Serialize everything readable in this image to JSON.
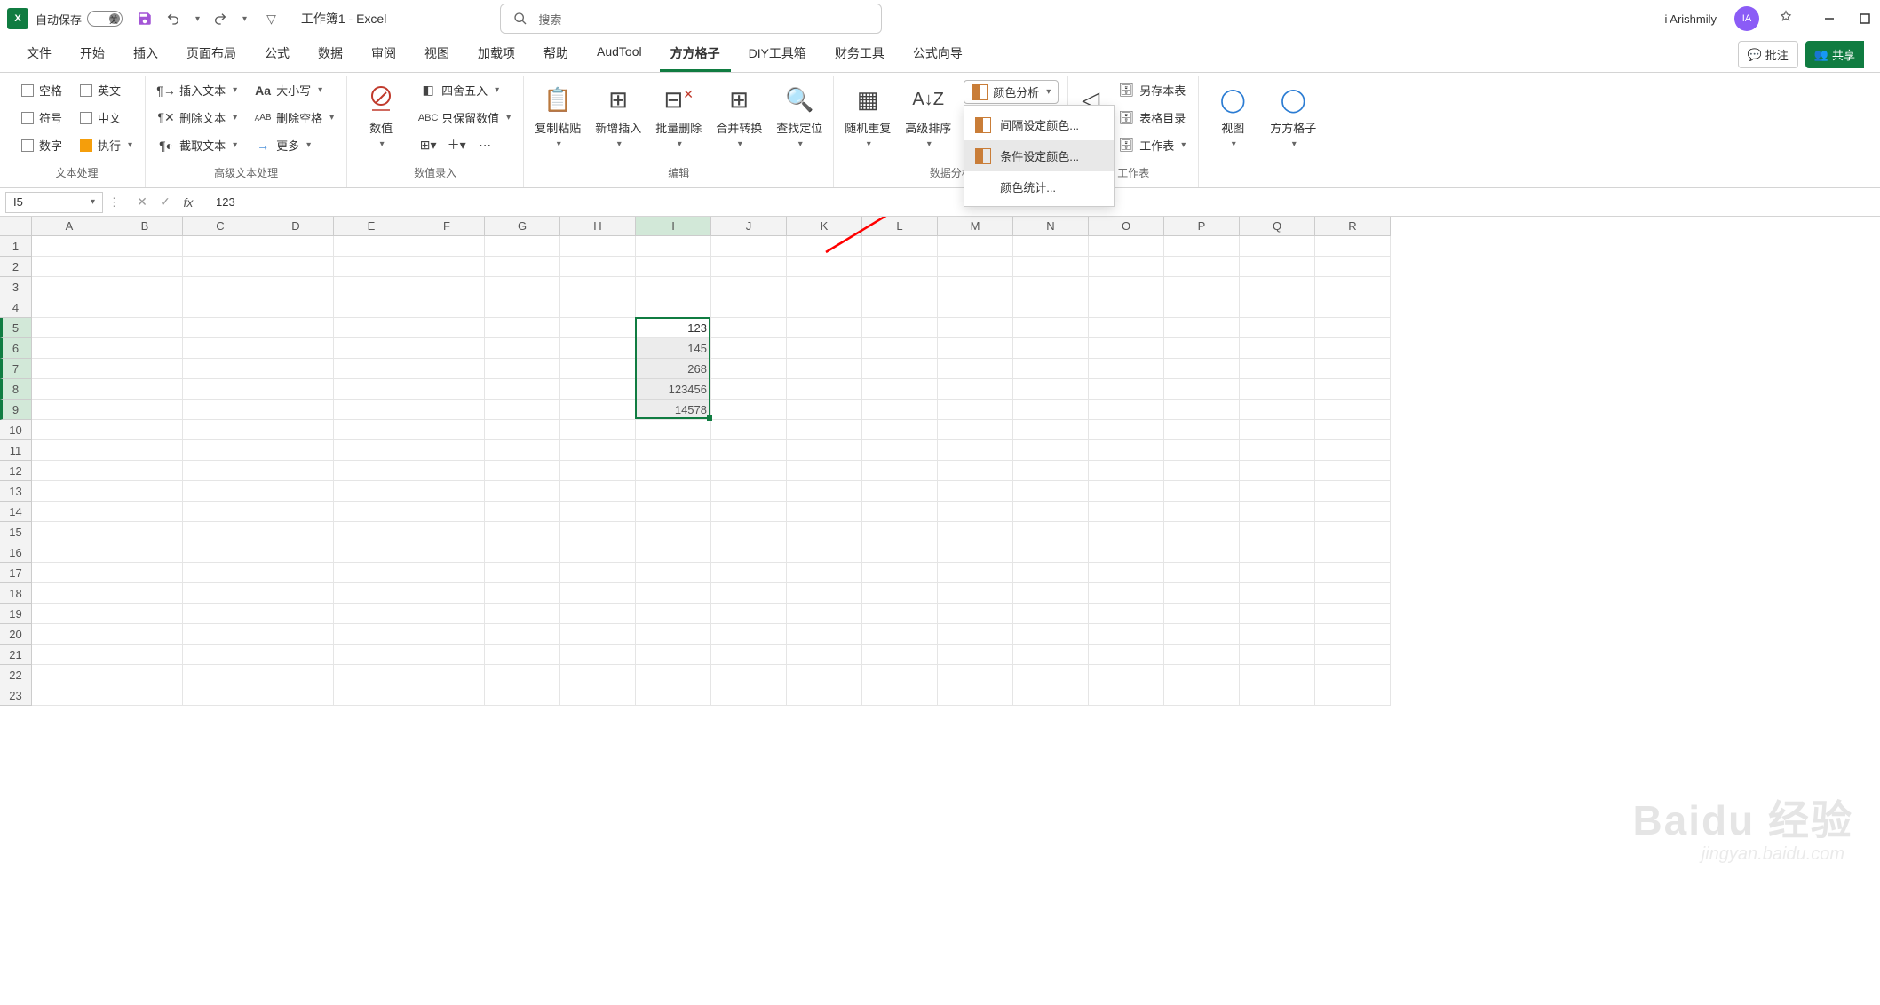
{
  "title_bar": {
    "app_icon_letter": "X",
    "autosave_label": "自动保存",
    "toggle_text": "关",
    "doc_title": "工作簿1  -  Excel",
    "search_placeholder": "搜索",
    "user_name": "i Arishmily",
    "user_initials": "IA"
  },
  "ribbon_tabs": [
    "文件",
    "开始",
    "插入",
    "页面布局",
    "公式",
    "数据",
    "审阅",
    "视图",
    "加载项",
    "帮助",
    "AudTool",
    "方方格子",
    "DIY工具箱",
    "财务工具",
    "公式向导"
  ],
  "active_tab_index": 11,
  "comments_btn": "批注",
  "share_btn": "共享",
  "ribbon_groups": {
    "text_processing": {
      "label": "文本处理",
      "items": [
        "空格",
        "英文",
        "符号",
        "中文",
        "数字",
        "执行"
      ]
    },
    "adv_text": {
      "label": "高级文本处理",
      "insert_text": "插入文本",
      "delete_text": "删除文本",
      "extract_text": "截取文本",
      "case": "大小写",
      "del_space": "删除空格",
      "more": "更多"
    },
    "num_input": {
      "label": "数值录入",
      "value": "数值",
      "round": "四舍五入",
      "keep_num": "只保留数值"
    },
    "edit": {
      "label": "编辑",
      "copy_paste": "复制粘贴",
      "new_insert": "新增插入",
      "batch_del": "批量删除",
      "merge_trans": "合并转换",
      "find_locate": "查找定位"
    },
    "data_analysis": {
      "label": "数据分析",
      "random_repeat": "随机重复",
      "adv_sort": "高级排序",
      "color_analyze": "颜色分析",
      "menu": {
        "interval_color": "间隔设定颜色...",
        "condition_color": "条件设定颜色...",
        "color_stats": "颜色统计..."
      }
    },
    "worksheet": {
      "label": "工作表",
      "save_table": "另存本表",
      "table_toc": "表格目录",
      "worksheets": "工作表"
    },
    "view": {
      "label": "",
      "view": "视图",
      "ffgz": "方方格子"
    }
  },
  "formula_bar": {
    "name_box": "I5",
    "formula": "123"
  },
  "columns": [
    "A",
    "B",
    "C",
    "D",
    "E",
    "F",
    "G",
    "H",
    "I",
    "J",
    "K",
    "L",
    "M",
    "N",
    "O",
    "P",
    "Q",
    "R"
  ],
  "selected_col_index": 8,
  "row_count": 23,
  "selected_rows": [
    5,
    6,
    7,
    8,
    9
  ],
  "cell_data": {
    "I5": "123",
    "I6": "145",
    "I7": "268",
    "I8": "123456",
    "I9": "14578"
  },
  "selection": {
    "col": "I",
    "row_start": 5,
    "row_end": 9
  },
  "watermark": {
    "main": "Baidu 经验",
    "sub": "jingyan.baidu.com"
  }
}
